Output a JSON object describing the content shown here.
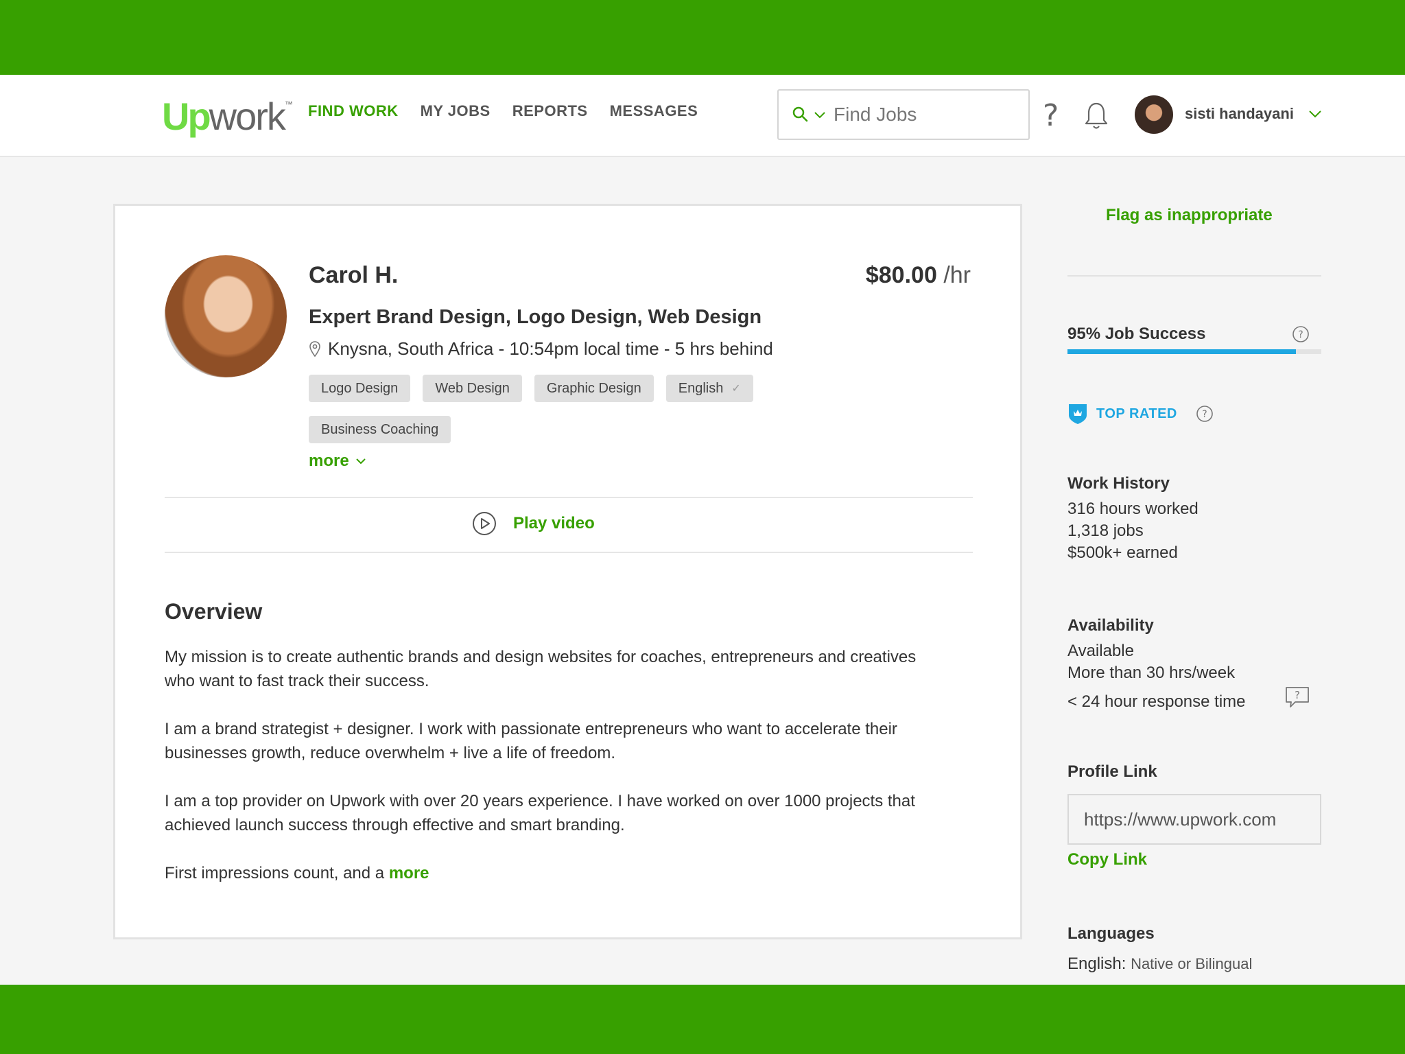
{
  "header": {
    "logo_up": "Up",
    "logo_work": "work",
    "logo_tm": "™",
    "nav": [
      "FIND WORK",
      "MY JOBS",
      "REPORTS",
      "MESSAGES"
    ],
    "active_nav": "FIND WORK",
    "search_placeholder": "Find Jobs",
    "help": "?",
    "user_name": "sisti handayani"
  },
  "profile": {
    "name": "Carol H.",
    "rate": "$80.00",
    "rate_unit": "/hr",
    "title": "Expert Brand Design, Logo Design, Web Design",
    "location": "Knysna, South Africa - 10:54pm local time - 5 hrs behind",
    "skills": [
      "Logo Design",
      "Web Design",
      "Graphic Design",
      "English",
      "Business Coaching"
    ],
    "more_label": "more",
    "play_video": "Play video",
    "overview_title": "Overview",
    "overview": [
      "My mission is to create authentic brands and design websites for coaches, entrepreneurs and creatives who want to fast track their success.",
      "I am a brand strategist + designer. I work with passionate entrepreneurs who want to accelerate their businesses growth, reduce overwhelm + live a life of freedom.",
      "I am a top provider on Upwork with over 20 years experience. I have worked on over 1000 projects that achieved launch success through effective and smart branding.",
      "First impressions count, and a"
    ],
    "overview_more": "more"
  },
  "sidebar": {
    "flag": "Flag as inappropriate",
    "job_success_label": "95% Job Success",
    "job_success_fraction": 0.9,
    "top_rated": "TOP RATED",
    "work_history": {
      "title": "Work History",
      "hours": "316 hours worked",
      "jobs": "1,318 jobs",
      "earned": "$500k+ earned"
    },
    "availability": {
      "title": "Availability",
      "status": "Available",
      "hours": "More than 30 hrs/week",
      "response": "< 24 hour response time"
    },
    "profile_link": {
      "title": "Profile Link",
      "value": "https://www.upwork.com",
      "copy": "Copy Link"
    },
    "languages": {
      "title": "Languages",
      "language": "English:",
      "level": "Native or Bilingual"
    }
  },
  "colors": {
    "brand_green": "#37a000",
    "logo_green": "#6fda44",
    "accent_blue": "#1fa7e1"
  }
}
